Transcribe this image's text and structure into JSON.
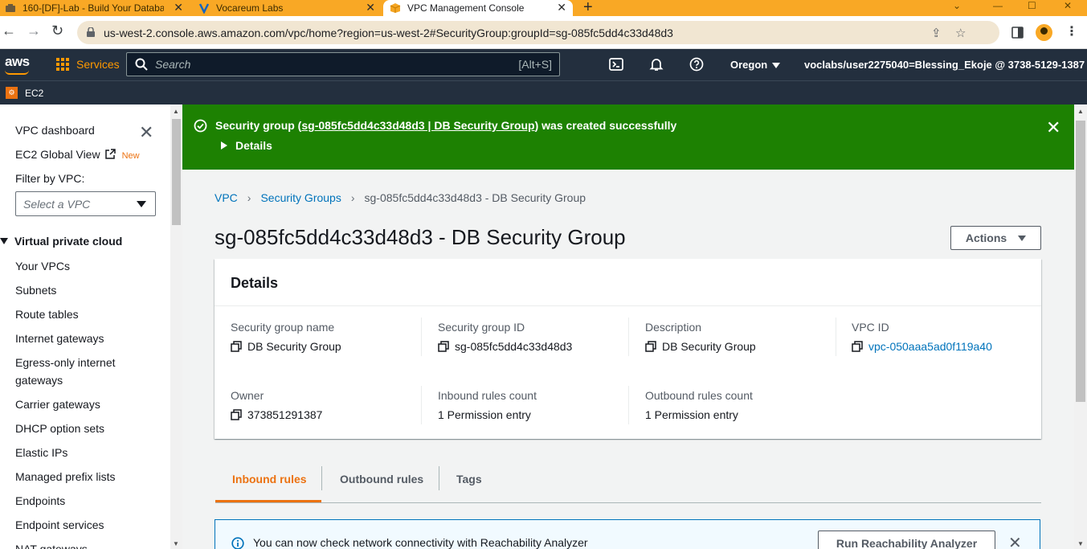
{
  "browser": {
    "tabs": [
      {
        "label": "160-[DF]-Lab - Build Your Databa",
        "icon": "lab-icon"
      },
      {
        "label": "Vocareum Labs",
        "icon": "vocareum-icon"
      },
      {
        "label": "VPC Management Console",
        "icon": "aws-box-icon",
        "active": true
      }
    ],
    "url": "us-west-2.console.aws.amazon.com/vpc/home?region=us-west-2#SecurityGroup:groupId=sg-085fc5dd4c33d48d3"
  },
  "aws_nav": {
    "logo": "aws",
    "services_label": "Services",
    "search_placeholder": "Search",
    "search_shortcut": "[Alt+S]",
    "region": "Oregon",
    "account": "voclabs/user2275040=Blessing_Ekoje @ 3738-5129-1387",
    "favorite": "EC2"
  },
  "sidebar": {
    "dashboard": "VPC dashboard",
    "global_view": "EC2 Global View",
    "new_badge": "New",
    "filter_label": "Filter by VPC:",
    "filter_placeholder": "Select a VPC",
    "section": "Virtual private cloud",
    "items": [
      "Your VPCs",
      "Subnets",
      "Route tables",
      "Internet gateways",
      "Egress-only internet",
      "gateways",
      "Carrier gateways",
      "DHCP option sets",
      "Elastic IPs",
      "Managed prefix lists",
      "Endpoints",
      "Endpoint services",
      "NAT gateways"
    ]
  },
  "flash": {
    "prefix": "Security group (",
    "link": "sg-085fc5dd4c33d48d3 | DB Security Group",
    "suffix": ") was created successfully",
    "details": "Details",
    "color": "#1d8102"
  },
  "breadcrumb": {
    "root": "VPC",
    "parent": "Security Groups",
    "current": "sg-085fc5dd4c33d48d3 - DB Security Group"
  },
  "page": {
    "title": "sg-085fc5dd4c33d48d3 - DB Security Group",
    "actions_label": "Actions"
  },
  "details": {
    "heading": "Details",
    "fields": {
      "sg_name": {
        "label": "Security group name",
        "value": "DB Security Group"
      },
      "sg_id": {
        "label": "Security group ID",
        "value": "sg-085fc5dd4c33d48d3"
      },
      "description": {
        "label": "Description",
        "value": "DB Security Group"
      },
      "vpc_id": {
        "label": "VPC ID",
        "value": "vpc-050aaa5ad0f119a40"
      },
      "owner": {
        "label": "Owner",
        "value": "373851291387"
      },
      "inbound_count": {
        "label": "Inbound rules count",
        "value": "1 Permission entry"
      },
      "outbound_count": {
        "label": "Outbound rules count",
        "value": "1 Permission entry"
      }
    }
  },
  "tabs": {
    "inbound": "Inbound rules",
    "outbound": "Outbound rules",
    "tags": "Tags",
    "active_color": "#ec7211"
  },
  "info": {
    "text": "You can now check network connectivity with Reachability Analyzer",
    "button": "Run Reachability Analyzer"
  }
}
